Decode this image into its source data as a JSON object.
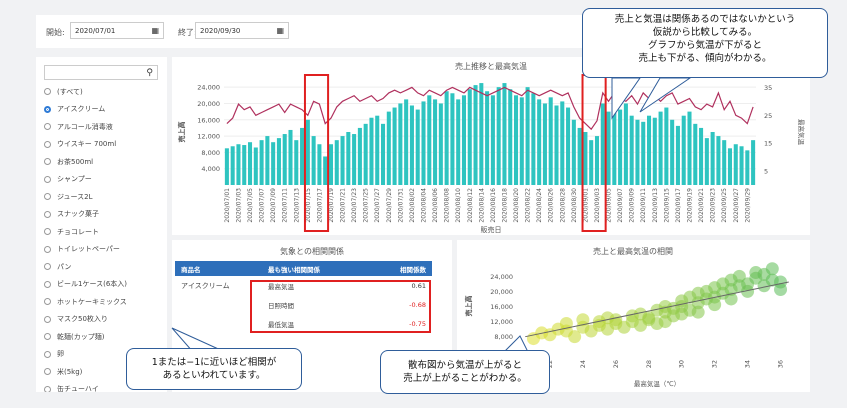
{
  "filters": {
    "start_label": "開始:",
    "start_value": "2020/07/01",
    "end_label": "終了:",
    "end_value": "2020/09/30"
  },
  "sidebar": {
    "search_placeholder": "",
    "items": [
      {
        "label": "(すべて)",
        "selected": false
      },
      {
        "label": "アイスクリーム",
        "selected": true
      },
      {
        "label": "アルコール消毒液",
        "selected": false
      },
      {
        "label": "ウイスキー 700ml",
        "selected": false
      },
      {
        "label": "お茶500ml",
        "selected": false
      },
      {
        "label": "シャンプー",
        "selected": false
      },
      {
        "label": "ジュース2L",
        "selected": false
      },
      {
        "label": "スナック菓子",
        "selected": false
      },
      {
        "label": "チョコレート",
        "selected": false
      },
      {
        "label": "トイレットペーパー",
        "selected": false
      },
      {
        "label": "パン",
        "selected": false
      },
      {
        "label": "ビール1ケース(6本入)",
        "selected": false
      },
      {
        "label": "ホットケーキミックス",
        "selected": false
      },
      {
        "label": "マスク50枚入り",
        "selected": false
      },
      {
        "label": "乾麺(カップ麺)",
        "selected": false
      },
      {
        "label": "卵",
        "selected": false
      },
      {
        "label": "米(5kg)",
        "selected": false
      },
      {
        "label": "缶チューハイ",
        "selected": false
      }
    ]
  },
  "correlation": {
    "title": "気象との相関関係",
    "headers": [
      "商品名",
      "最も強い相関関係",
      "相関係数"
    ],
    "product": "アイスクリーム",
    "rows": [
      {
        "factor": "最高気温",
        "value": "0.61",
        "color": "#333333"
      },
      {
        "factor": "日照時間",
        "value": "-0.68",
        "color": "#e02020"
      },
      {
        "factor": "最低気温",
        "value": "-0.75",
        "color": "#e02020"
      }
    ]
  },
  "callouts": {
    "top": "売上と気温は関係あるのではないかという\n仮説から比較してみる。\nグラフから気温が下がると\n売上も下がる、傾向がわかる。",
    "bottom_left": "1または−1に近いほど相関が\nあるといわれています。",
    "bottom_mid": "散布図から気温が上がると\n売上が上がることがわかる。"
  },
  "chart_data": [
    {
      "type": "bar",
      "title": "売上推移と最高気温",
      "xlabel": "販売日",
      "ylabel": "売上高",
      "y2label": "最高気温",
      "ylim": [
        0,
        26000
      ],
      "y2lim": [
        0,
        38
      ],
      "yticks": [
        "24,000",
        "20,000",
        "16,000",
        "12,000",
        "8,000",
        "4,000"
      ],
      "y2ticks": [
        "35",
        "25",
        "15",
        "5"
      ],
      "colors": {
        "bars": "#2ec4c0",
        "line": "#b0315e"
      },
      "x": [
        "2020/07/01",
        "2020/07/02",
        "2020/07/03",
        "2020/07/04",
        "2020/07/05",
        "2020/07/06",
        "2020/07/07",
        "2020/07/08",
        "2020/07/09",
        "2020/07/10",
        "2020/07/11",
        "2020/07/12",
        "2020/07/13",
        "2020/07/14",
        "2020/07/15",
        "2020/07/16",
        "2020/07/17",
        "2020/07/18",
        "2020/07/19",
        "2020/07/20",
        "2020/07/21",
        "2020/07/22",
        "2020/07/23",
        "2020/07/24",
        "2020/07/25",
        "2020/07/26",
        "2020/07/27",
        "2020/07/28",
        "2020/07/29",
        "2020/07/30",
        "2020/07/31",
        "2020/08/01",
        "2020/08/02",
        "2020/08/03",
        "2020/08/04",
        "2020/08/05",
        "2020/08/06",
        "2020/08/07",
        "2020/08/08",
        "2020/08/09",
        "2020/08/10",
        "2020/08/11",
        "2020/08/12",
        "2020/08/13",
        "2020/08/14",
        "2020/08/15",
        "2020/08/16",
        "2020/08/17",
        "2020/08/18",
        "2020/08/19",
        "2020/08/20",
        "2020/08/21",
        "2020/08/22",
        "2020/08/23",
        "2020/08/24",
        "2020/08/25",
        "2020/08/26",
        "2020/08/27",
        "2020/08/28",
        "2020/08/29",
        "2020/08/30",
        "2020/08/31",
        "2020/09/01",
        "2020/09/02",
        "2020/09/03",
        "2020/09/04",
        "2020/09/05",
        "2020/09/06",
        "2020/09/07",
        "2020/09/08",
        "2020/09/09",
        "2020/09/10",
        "2020/09/11",
        "2020/09/12",
        "2020/09/13",
        "2020/09/14",
        "2020/09/15",
        "2020/09/16",
        "2020/09/17",
        "2020/09/18",
        "2020/09/19",
        "2020/09/20",
        "2020/09/21",
        "2020/09/22",
        "2020/09/23",
        "2020/09/24",
        "2020/09/25",
        "2020/09/26",
        "2020/09/27",
        "2020/09/28",
        "2020/09/29",
        "2020/09/30"
      ],
      "xticks": [
        "2020/07/01",
        "2020/07/03",
        "2020/07/05",
        "2020/07/07",
        "2020/07/09",
        "2020/07/11",
        "2020/07/13",
        "2020/07/15",
        "2020/07/17",
        "2020/07/19",
        "2020/07/21",
        "2020/07/23",
        "2020/07/25",
        "2020/07/27",
        "2020/07/29",
        "2020/07/31",
        "2020/08/02",
        "2020/08/04",
        "2020/08/06",
        "2020/08/08",
        "2020/08/10",
        "2020/08/12",
        "2020/08/14",
        "2020/08/16",
        "2020/08/18",
        "2020/08/20",
        "2020/08/22",
        "2020/08/24",
        "2020/08/26",
        "2020/08/28",
        "2020/08/30",
        "2020/09/01",
        "2020/09/03",
        "2020/09/05",
        "2020/09/07",
        "2020/09/09",
        "2020/09/11",
        "2020/09/13",
        "2020/09/15",
        "2020/09/17",
        "2020/09/19",
        "2020/09/21",
        "2020/09/23",
        "2020/09/25",
        "2020/09/27",
        "2020/09/29"
      ],
      "series": [
        {
          "name": "売上高",
          "kind": "bar",
          "values": [
            9000,
            9500,
            10000,
            9800,
            10500,
            9200,
            11000,
            12000,
            10500,
            11500,
            12500,
            13500,
            11000,
            14000,
            16000,
            12000,
            10000,
            7000,
            10000,
            11000,
            12000,
            13000,
            12500,
            14000,
            15000,
            16500,
            17000,
            15000,
            18000,
            19000,
            20000,
            21000,
            19500,
            18500,
            20500,
            22000,
            21000,
            20000,
            23000,
            22500,
            21000,
            22000,
            23500,
            24500,
            25000,
            23000,
            22000,
            24000,
            25000,
            23500,
            22000,
            21500,
            24000,
            22500,
            21000,
            20000,
            21500,
            19500,
            20500,
            19000,
            16000,
            14000,
            13000,
            11000,
            12000,
            20000,
            18000,
            21000,
            18500,
            20000,
            17000,
            16000,
            15500,
            17000,
            16500,
            18000,
            19000,
            16000,
            14500,
            17000,
            18000,
            15000,
            14000,
            11500,
            13000,
            12000,
            11000,
            9000,
            10000,
            9500,
            8500,
            11000
          ],
          "labels": []
        },
        {
          "name": "最高気温",
          "kind": "line",
          "axis": "y2",
          "values": [
            22,
            24,
            29,
            27,
            28,
            25,
            26,
            27,
            28,
            29,
            26,
            29,
            28,
            27,
            25,
            30,
            29,
            22,
            24,
            28,
            30,
            31,
            32,
            30,
            31,
            32,
            30,
            31,
            33,
            34,
            33,
            34,
            35,
            33,
            32,
            34,
            33,
            32,
            34,
            35,
            34,
            33,
            35,
            34,
            33,
            32,
            33,
            34,
            35,
            34,
            33,
            32,
            34,
            33,
            32,
            33,
            34,
            33,
            32,
            33,
            28,
            24,
            22,
            20,
            23,
            33,
            30,
            33,
            31,
            30,
            32,
            29,
            33,
            31,
            32,
            30,
            32,
            33,
            29,
            30,
            31,
            28,
            27,
            29,
            28,
            33,
            27,
            30,
            25,
            24,
            22,
            28
          ]
        }
      ],
      "annotations": [
        {
          "type": "highlight",
          "from": "2020/07/15",
          "to": "2020/07/18",
          "color": "#e02020"
        },
        {
          "type": "highlight",
          "from": "2020/09/01",
          "to": "2020/09/04",
          "color": "#e02020"
        }
      ]
    },
    {
      "type": "scatter",
      "title": "売上と最高気温の相関",
      "xlabel": "最高気温（℃）",
      "ylabel": "売上高",
      "xlim": [
        20,
        37
      ],
      "ylim": [
        5000,
        27000
      ],
      "xticks": [
        "22",
        "24",
        "26",
        "28",
        "30",
        "32",
        "34",
        "36"
      ],
      "yticks": [
        "24,000",
        "20,000",
        "16,000",
        "12,000",
        "8,000"
      ],
      "trendline": {
        "from": [
          20.5,
          8000
        ],
        "to": [
          36.5,
          22500
        ],
        "color": "#666666"
      },
      "points": [
        [
          21,
          7500
        ],
        [
          21.5,
          9000
        ],
        [
          22,
          8500
        ],
        [
          22.5,
          10000
        ],
        [
          23,
          9500
        ],
        [
          23,
          11500
        ],
        [
          23.5,
          8000
        ],
        [
          24,
          10500
        ],
        [
          24,
          12500
        ],
        [
          24.5,
          9500
        ],
        [
          25,
          11000
        ],
        [
          25,
          12000
        ],
        [
          25.5,
          10000
        ],
        [
          25.5,
          13000
        ],
        [
          26,
          11500
        ],
        [
          26,
          12500
        ],
        [
          26.5,
          10500
        ],
        [
          27,
          12000
        ],
        [
          27,
          13500
        ],
        [
          27.5,
          11000
        ],
        [
          27.5,
          14000
        ],
        [
          28,
          12500
        ],
        [
          28,
          13000
        ],
        [
          28.5,
          15000
        ],
        [
          28.5,
          11500
        ],
        [
          29,
          14500
        ],
        [
          29,
          16000
        ],
        [
          29,
          12000
        ],
        [
          29.5,
          15500
        ],
        [
          29.5,
          13500
        ],
        [
          30,
          16000
        ],
        [
          30,
          17500
        ],
        [
          30,
          14000
        ],
        [
          30.5,
          18500
        ],
        [
          30.5,
          15000
        ],
        [
          31,
          17000
        ],
        [
          31,
          19500
        ],
        [
          31,
          14500
        ],
        [
          31.5,
          18000
        ],
        [
          31.5,
          20000
        ],
        [
          32,
          18500
        ],
        [
          32,
          21000
        ],
        [
          32,
          16500
        ],
        [
          32.5,
          19500
        ],
        [
          32.5,
          22000
        ],
        [
          33,
          20500
        ],
        [
          33,
          23000
        ],
        [
          33,
          18000
        ],
        [
          33.5,
          21500
        ],
        [
          33.5,
          24000
        ],
        [
          34,
          22000
        ],
        [
          34,
          20000
        ],
        [
          34.5,
          23500
        ],
        [
          34.5,
          25000
        ],
        [
          35,
          21500
        ],
        [
          35,
          24500
        ],
        [
          35.5,
          23000
        ],
        [
          35.5,
          26000
        ],
        [
          36,
          22500
        ],
        [
          36,
          20500
        ]
      ]
    }
  ]
}
